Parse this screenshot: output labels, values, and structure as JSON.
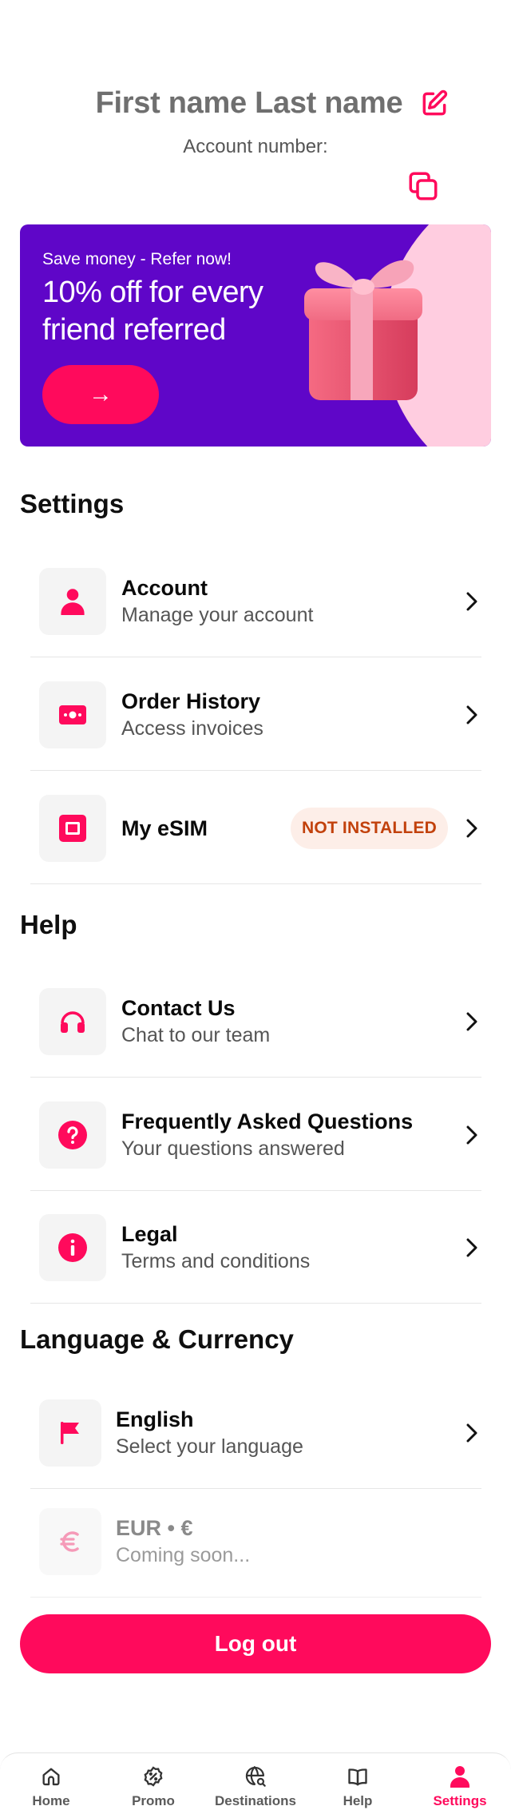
{
  "profile": {
    "name": "First name Last name",
    "account_number_label": "Account number:"
  },
  "promo": {
    "kicker": "Save money - Refer now!",
    "title": "10% off for every friend referred",
    "button_arrow": "→"
  },
  "settings": {
    "title": "Settings",
    "items": [
      {
        "title": "Account",
        "subtitle": "Manage your account",
        "icon": "person-icon"
      },
      {
        "title": "Order History",
        "subtitle": "Access invoices",
        "icon": "receipt-icon"
      },
      {
        "title": "My eSIM",
        "subtitle": "",
        "badge": "NOT INSTALLED",
        "icon": "sim-card-icon"
      }
    ]
  },
  "help": {
    "title": "Help",
    "items": [
      {
        "title": "Contact Us",
        "subtitle": "Chat to our team",
        "icon": "headset-icon"
      },
      {
        "title": "Frequently Asked Questions",
        "subtitle": "Your questions answered",
        "icon": "question-icon"
      },
      {
        "title": "Legal",
        "subtitle": "Terms and conditions",
        "icon": "info-icon"
      }
    ]
  },
  "language_currency": {
    "title": "Language & Currency",
    "items": [
      {
        "title": "English",
        "subtitle": "Select your language",
        "icon": "flag-icon"
      },
      {
        "title": "EUR • €",
        "subtitle": "Coming soon...",
        "icon": "euro-icon"
      }
    ]
  },
  "logout_label": "Log out",
  "tabbar": {
    "tabs": [
      {
        "label": "Home",
        "icon": "home-icon"
      },
      {
        "label": "Promo",
        "icon": "promo-badge-icon"
      },
      {
        "label": "Destinations",
        "icon": "globe-search-icon"
      },
      {
        "label": "Help",
        "icon": "book-icon"
      },
      {
        "label": "Settings",
        "icon": "person-icon",
        "active": true
      }
    ]
  },
  "colors": {
    "accent": "#ff0a5c",
    "promo_bg": "#5f06c8",
    "promo_pink": "#ffcde0",
    "badge_bg": "#fdeee8",
    "badge_text": "#c2410c"
  }
}
